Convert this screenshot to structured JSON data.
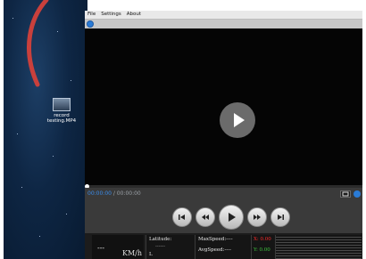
{
  "desktop": {
    "icon_label_line1": "record",
    "icon_label_line2": "testing.MP4"
  },
  "menu": [
    "File",
    "Settings",
    "About"
  ],
  "player": {
    "time_current": "00:00:00",
    "time_separator": " / ",
    "time_total": "00:00:00",
    "speed_value": "---",
    "speed_unit": "KM/h",
    "latitude_label": "Latitude:",
    "latitude_value": "------",
    "longitude_label": "L",
    "max_speed_label": "MaxSpeed:----",
    "avg_speed_label": "AvgSpeed:----",
    "x_label": "X: 0.00",
    "y_label": "Y: 0.00"
  },
  "colors": {
    "accent": "#3a8be8",
    "x_color": "#ff2a2a",
    "y_color": "#3ec43e"
  }
}
